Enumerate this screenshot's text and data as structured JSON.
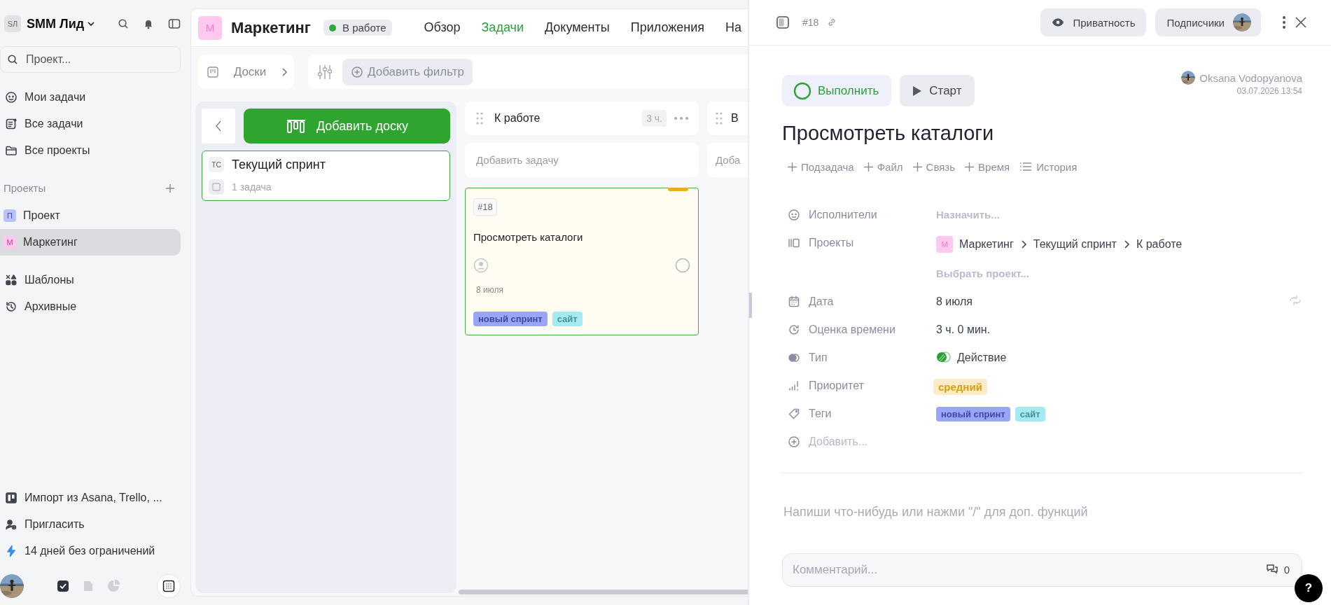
{
  "sidebar": {
    "workspace": {
      "initials": "SЛ",
      "name": "SMM Лид"
    },
    "search": {
      "placeholder": "Проект..."
    },
    "nav": [
      {
        "label": "Мои задачи"
      },
      {
        "label": "Все задачи"
      },
      {
        "label": "Все проекты"
      }
    ],
    "projects_heading": "Проекты",
    "projects": [
      {
        "initials": "П",
        "name": "Проект",
        "color": "#b8c2fb",
        "selected": false
      },
      {
        "initials": "М",
        "name": "Маркетинг",
        "color": "#ffc8ef",
        "selected": true
      }
    ],
    "library": [
      {
        "label": "Шаблоны"
      },
      {
        "label": "Архивные"
      }
    ],
    "footer": [
      {
        "label": "Импорт из Asana, Trello, ..."
      },
      {
        "label": "Пригласить"
      },
      {
        "label": "14 дней без ограничений"
      }
    ]
  },
  "project": {
    "initials": "М",
    "title": "Маркетинг",
    "status": "В работе",
    "tabs": [
      {
        "label": "Обзор",
        "selected": false
      },
      {
        "label": "Задачи",
        "selected": true
      },
      {
        "label": "Документы",
        "selected": false
      },
      {
        "label": "Приложения",
        "selected": false
      },
      {
        "label": "На",
        "selected": false
      }
    ]
  },
  "toolbar": {
    "boards": "Доски",
    "add_filter": "Добавить фильтр"
  },
  "boards": {
    "add_board": "Добавить доску",
    "items": [
      {
        "initials": "ТС",
        "name": "Текущий спринт",
        "count": "1 задача",
        "selected": true
      }
    ]
  },
  "columns": [
    {
      "title": "К работе",
      "estimate": "3 ч.",
      "add_task": "Добавить задачу",
      "cards": [
        {
          "number": "#18",
          "title": "Просмотреть каталоги",
          "date": "8 июля",
          "tags": [
            {
              "label": "новый спринт",
              "color": "#9aa6f5"
            },
            {
              "label": "сайт",
              "color": "#a6eaf0"
            }
          ]
        }
      ]
    },
    {
      "title": "В",
      "add_task": "Доба"
    }
  ],
  "task": {
    "number": "#18",
    "privacy": "Приватность",
    "subscribers": "Подписчики",
    "complete": "Выполнить",
    "start": "Старт",
    "author": "Oksana Vodopyanova",
    "created": "03.07.2026 13:54",
    "title": "Просмотреть каталоги",
    "actions": [
      "Подзадача",
      "Файл",
      "Связь",
      "Время",
      "История"
    ],
    "fields": [
      {
        "kind": "placeholder",
        "label": "Исполнители",
        "placeholder": "Назначить..."
      },
      {
        "kind": "path",
        "label": "Проекты",
        "project_initials": "М",
        "path": [
          "Маркетинг",
          "Текущий спринт",
          "К работе"
        ],
        "hint": "Выбрать проект..."
      },
      {
        "kind": "date",
        "label": "Дата",
        "value": "8 июля"
      },
      {
        "kind": "text",
        "label": "Оценка времени",
        "value": "3 ч. 0 мин."
      },
      {
        "kind": "type",
        "label": "Тип",
        "value": "Действие"
      },
      {
        "kind": "badge",
        "label": "Приоритет",
        "value": "средний"
      },
      {
        "kind": "tags",
        "label": "Теги",
        "tags": [
          {
            "label": "новый спринт",
            "color": "#9aa6f5"
          },
          {
            "label": "сайт",
            "color": "#a6eaf0"
          }
        ]
      },
      {
        "kind": "add",
        "label": "Добавить..."
      }
    ],
    "description_placeholder": "Напиши что-нибудь или нажми \"/\" для доп. функций",
    "comment": {
      "placeholder": "Комментарий...",
      "count": "0"
    }
  },
  "help": "?"
}
